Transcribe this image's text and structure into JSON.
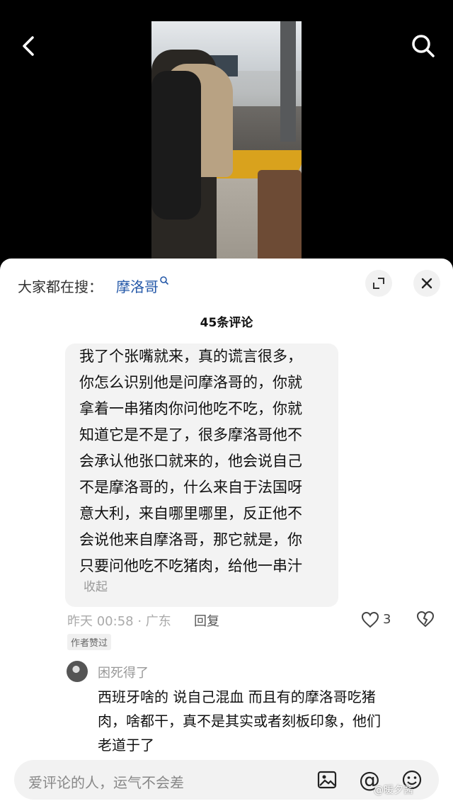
{
  "header": {
    "back_icon": "chevron-left-icon",
    "search_icon": "search-icon"
  },
  "sheet": {
    "searching_label": "大家都在搜：",
    "searching_term": "摩洛哥",
    "comment_count": "45条评论"
  },
  "comment": {
    "lines": [
      "我了个张嘴就来，真的谎言很多，",
      "你怎么识别他是问摩洛哥的，你就",
      "拿着一串猪肉你问他吃不吃，你就",
      "知道它是不是了，很多摩洛哥他不",
      "会承认他张口就来的，他会说自己",
      "不是摩洛哥的，什么来自于法国呀",
      "意大利，来自哪里哪里，反正他不",
      "会说他来自摩洛哥，那它就是，你",
      "只要问他吃不吃猪肉，给他一串汁"
    ],
    "collapse": "收起",
    "meta": "昨天 00:58 · 广东",
    "reply": "回复",
    "likes": "3",
    "author_badge": "作者赞过"
  },
  "subcomment": {
    "name": "困死得了",
    "lines": [
      "西班牙啥的 说自己混血 而且有的摩洛哥吃猪",
      "肉，啥都干，真不是其实或者刻板印象，他们",
      "老道于了"
    ]
  },
  "input": {
    "placeholder": "爱评论的人，运气不会差",
    "at_symbol": "@",
    "watermark": "@暖夕酱"
  }
}
